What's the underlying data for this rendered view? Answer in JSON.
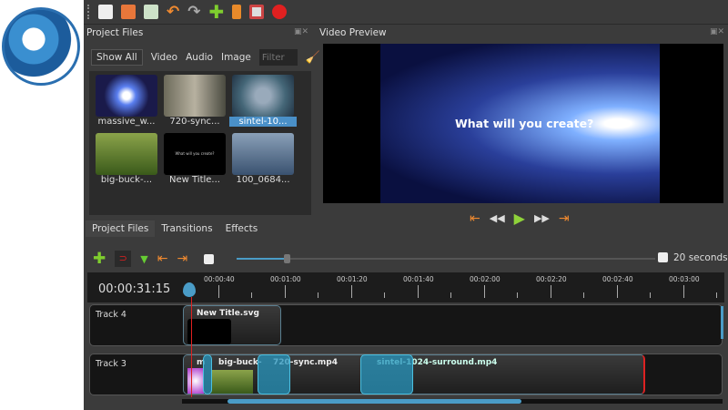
{
  "toolbar": {
    "icons": [
      "new-project-icon",
      "open-project-icon",
      "save-project-icon",
      "undo-icon",
      "redo-icon",
      "import-files-icon",
      "choose-profile-icon",
      "fullscreen-icon",
      "export-video-icon"
    ]
  },
  "project_files": {
    "title": "Project Files",
    "filters": [
      "Show All",
      "Video",
      "Audio",
      "Image"
    ],
    "filter_placeholder": "Filter",
    "files": [
      {
        "name": "massive_w...",
        "selected": false
      },
      {
        "name": "720-sync...",
        "selected": false
      },
      {
        "name": "sintel-10...",
        "selected": true
      },
      {
        "name": "big-buck-...",
        "selected": false
      },
      {
        "name": "New Title...",
        "selected": false
      },
      {
        "name": "100_0684...",
        "selected": false
      }
    ],
    "title_thumb_text": "What will you create?"
  },
  "video_preview": {
    "title": "Video Preview",
    "overlay_text": "What will you create?"
  },
  "bottom_tabs": [
    "Project Files",
    "Transitions",
    "Effects"
  ],
  "timeline": {
    "current_time": "00:00:31:15",
    "zoom_label": "20 seconds",
    "zoom_level": 0.12,
    "ruler": [
      "00:00:40",
      "00:01:00",
      "00:01:20",
      "00:01:40",
      "00:02:00",
      "00:02:20",
      "00:02:40",
      "00:03:00"
    ],
    "tracks": [
      {
        "name": "Track 4",
        "clips": [
          "New Title.svg"
        ]
      },
      {
        "name": "Track 3",
        "clips": [
          "m",
          "big-buck-",
          "720-sync.mp4",
          "sintel-1024-surround.mp4"
        ]
      }
    ]
  },
  "colors": {
    "accent": "#4a9cc7",
    "playhead": "#e02020",
    "record": "#e02020"
  }
}
